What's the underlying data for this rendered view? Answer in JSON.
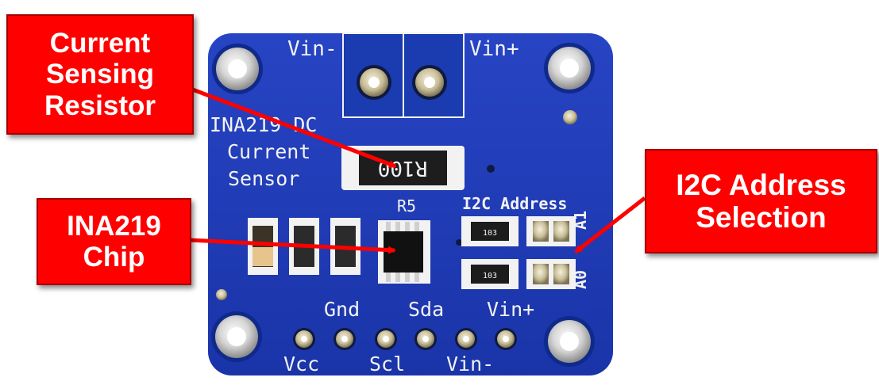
{
  "board": {
    "label_vin_minus_top": "Vin-",
    "label_vin_plus_top": "Vin+",
    "title_line1": "INA219 DC",
    "title_line2": "Current",
    "title_line3": "Sensor",
    "resistor_marking": "R100",
    "resistor_designator": "R5",
    "i2c_label": "I2C Address",
    "a1_label": "A1",
    "a0_label": "A0",
    "smd_marking_1": "103",
    "smd_marking_2": "103",
    "pin_gnd": "Gnd",
    "pin_sda": "Sda",
    "pin_vin_plus": "Vin+",
    "pin_vcc": "Vcc",
    "pin_scl": "Scl",
    "pin_vin_minus": "Vin-"
  },
  "callouts": {
    "current_sensing_resistor": [
      "Current",
      "Sensing",
      "Resistor"
    ],
    "ina219_chip": [
      "INA219",
      "Chip"
    ],
    "i2c_address_selection": [
      "I2C Address",
      "Selection"
    ]
  },
  "colors": {
    "pcb_blue": "#1f3fb8",
    "callout_red": "#ff0000",
    "silkscreen": "#f2f2f2",
    "arrow_red": "#ff0000"
  }
}
